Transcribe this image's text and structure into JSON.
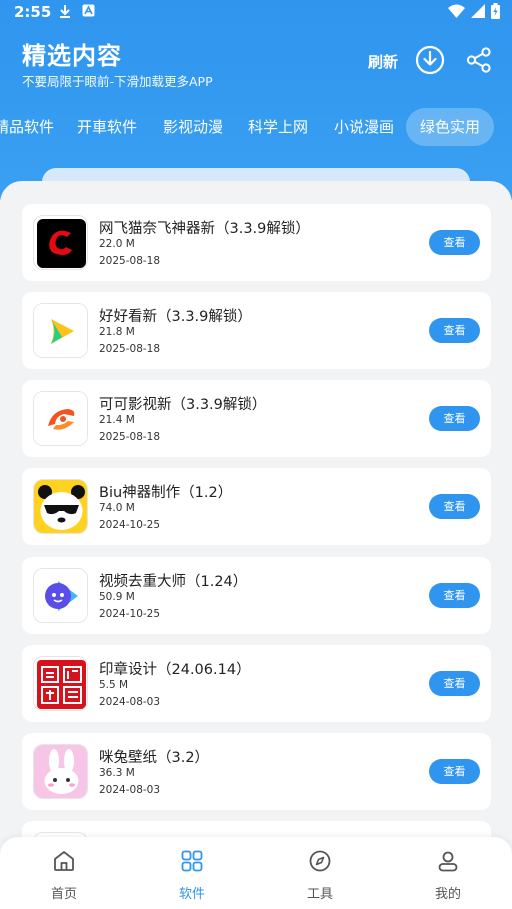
{
  "status_bar": {
    "time": "2:55",
    "left_icons": [
      "download-icon",
      "notification-icon"
    ],
    "right_icons": [
      "wifi-icon",
      "signal-icon",
      "battery-icon"
    ]
  },
  "header": {
    "title": "精选内容",
    "subtitle": "不要局限于眼前-下滑加载更多APP",
    "refresh_label": "刷新",
    "download_icon": "download-circle-icon",
    "share_icon": "share-icon"
  },
  "tabs": [
    {
      "label": "精品软件",
      "active": false
    },
    {
      "label": "开車软件",
      "active": false
    },
    {
      "label": "影视动漫",
      "active": false
    },
    {
      "label": "科学上网",
      "active": false
    },
    {
      "label": "小说漫画",
      "active": false
    },
    {
      "label": "绿色实用",
      "active": true
    }
  ],
  "apps": [
    {
      "name": "网飞猫奈飞神器新（3.3.9解锁）",
      "size": "22.0 M",
      "date": "2025-08-18",
      "action": "查看",
      "icon": "netflix-cat-icon"
    },
    {
      "name": "好好看新（3.3.9解锁）",
      "size": "21.8 M",
      "date": "2025-08-18",
      "action": "查看",
      "icon": "haohaokan-icon"
    },
    {
      "name": "可可影视新（3.3.9解锁）",
      "size": "21.4 M",
      "date": "2025-08-18",
      "action": "查看",
      "icon": "keke-video-icon"
    },
    {
      "name": "Biu神器制作（1.2）",
      "size": "74.0 M",
      "date": "2024-10-25",
      "action": "查看",
      "icon": "panda-sunglasses-icon"
    },
    {
      "name": "视频去重大师（1.24）",
      "size": "50.9 M",
      "date": "2024-10-25",
      "action": "查看",
      "icon": "video-dedupe-icon"
    },
    {
      "name": "印章设计（24.06.14）",
      "size": "5.5 M",
      "date": "2024-08-03",
      "action": "查看",
      "icon": "seal-stamp-icon"
    },
    {
      "name": "咪兔壁纸（3.2）",
      "size": "36.3 M",
      "date": "2024-08-03",
      "action": "查看",
      "icon": "bunny-wallpaper-icon"
    }
  ],
  "bottom_nav": [
    {
      "label": "首页",
      "icon": "home-icon",
      "active": false
    },
    {
      "label": "软件",
      "icon": "apps-grid-icon",
      "active": true
    },
    {
      "label": "工具",
      "icon": "compass-icon",
      "active": false
    },
    {
      "label": "我的",
      "icon": "profile-icon",
      "active": false
    }
  ],
  "colors": {
    "primary": "#2f95ee",
    "background": "#f2f3f5",
    "card": "#ffffff"
  }
}
